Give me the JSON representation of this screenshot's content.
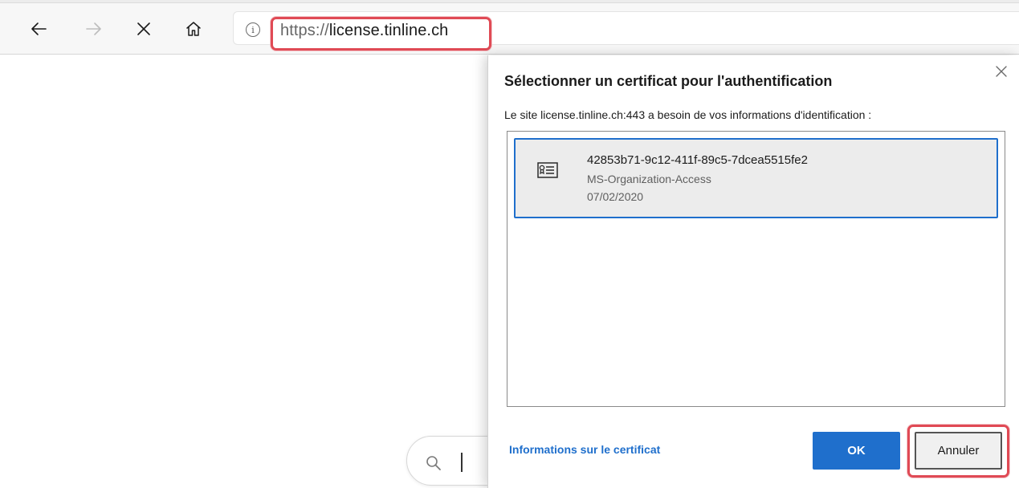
{
  "browser": {
    "nav": {
      "back_icon": "arrow-left-icon",
      "forward_icon": "arrow-right-icon",
      "stop_icon": "close-icon",
      "home_icon": "home-icon"
    },
    "address": {
      "info_icon": "info-icon",
      "info_glyph": "i",
      "url_scheme": "https://",
      "url_host": "license.tinline.ch"
    }
  },
  "page": {
    "search_icon": "search-icon"
  },
  "dialog": {
    "title": "Sélectionner un certificat pour l'authentification",
    "subtitle": "Le site license.tinline.ch:443 a besoin de vos informations d'identification :",
    "close_icon": "close-icon",
    "certificates": [
      {
        "name": "42853b71-9c12-411f-89c5-7dcea5515fe2",
        "issuer": "MS-Organization-Access",
        "date": "07/02/2020",
        "icon": "certificate-icon",
        "selected": true
      }
    ],
    "cert_info_link": "Informations sur le certificat",
    "ok_label": "OK",
    "cancel_label": "Annuler"
  },
  "colors": {
    "accent": "#1f6fcc",
    "highlight": "#e04a55"
  }
}
